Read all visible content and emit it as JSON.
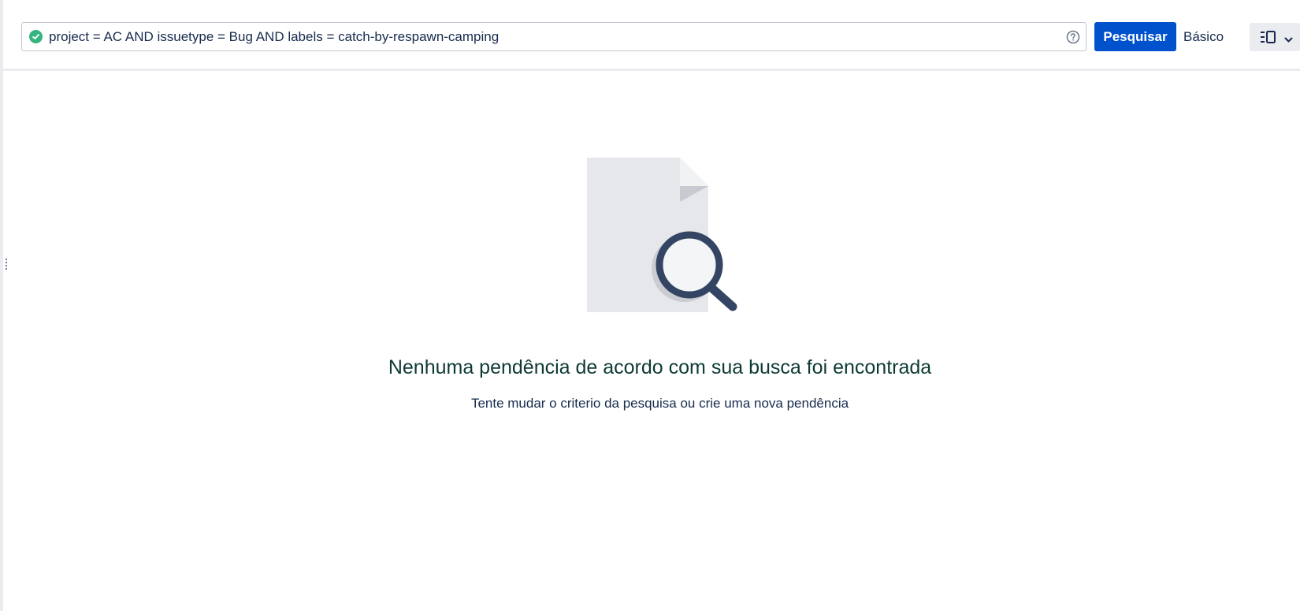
{
  "search": {
    "query": "project = AC AND issuetype = Bug AND labels = catch-by-respawn-camping",
    "valid_icon": "check-circle-icon",
    "help_icon": "question-circle-icon",
    "submit_label": "Pesquisar",
    "mode_toggle_label": "Básico",
    "view_switcher_icon": "list-view-icon"
  },
  "empty_state": {
    "illustration": "document-search-icon",
    "title": "Nenhuma pendência de acordo com sua busca foi encontrada",
    "subtitle": "Tente mudar o criterio da pesquisa ou crie uma nova pendência"
  },
  "colors": {
    "primary_button": "#0052cc",
    "valid": "#36b37e",
    "title": "#0e3a35"
  }
}
